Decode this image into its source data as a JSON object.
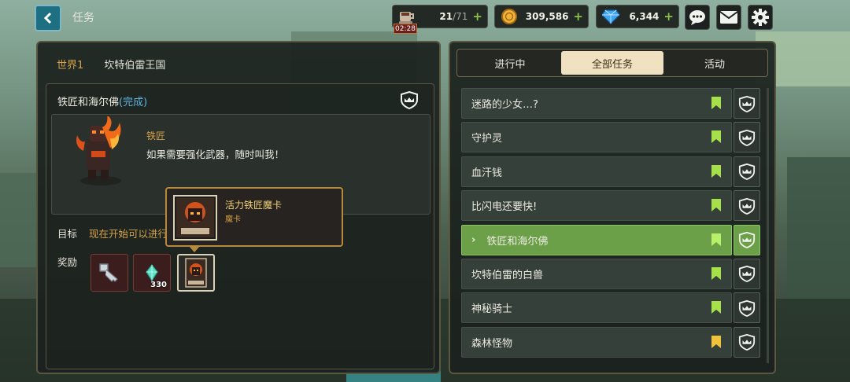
{
  "header": {
    "title": "任务",
    "stamina": {
      "current": "21",
      "max": "/71",
      "timer": "02:28"
    },
    "gold": "309,586",
    "gems": "6,344"
  },
  "left": {
    "world": "世界1",
    "area": "坎特伯雷王国",
    "quest_title": "铁匠和海尔佛",
    "quest_status": "(完成)",
    "npc_name": "铁匠",
    "npc_line": "如果需要强化武器，随时叫我！",
    "goal_label": "目标",
    "goal_text": "现在开始可以进行",
    "reward_label": "奖励",
    "rewards": [
      {
        "icon": "key-icon"
      },
      {
        "icon": "crystal-icon",
        "count": "330"
      },
      {
        "icon": "card-icon"
      }
    ],
    "tooltip": {
      "name": "活力铁匠魔卡",
      "type": "魔卡"
    }
  },
  "right": {
    "tabs": [
      {
        "label": "进行中",
        "active": false
      },
      {
        "label": "全部任务",
        "active": true
      },
      {
        "label": "活动",
        "active": false
      }
    ],
    "quests": [
      {
        "label": "迷路的少女…?",
        "flag": "#a6e04a",
        "active": false
      },
      {
        "label": "守护灵",
        "flag": "#a6e04a",
        "active": false
      },
      {
        "label": "血汗钱",
        "flag": "#a6e04a",
        "active": false
      },
      {
        "label": "比闪电还要快!",
        "flag": "#a6e04a",
        "active": false
      },
      {
        "label": "铁匠和海尔佛",
        "flag": "#b8f06a",
        "active": true
      },
      {
        "label": "坎特伯雷的白兽",
        "flag": "#a6e04a",
        "active": false
      },
      {
        "label": "神秘骑士",
        "flag": "#a6e04a",
        "active": false
      },
      {
        "label": "森林怪物",
        "flag": "#f0c23a",
        "active": false
      }
    ]
  },
  "colors": {
    "accent_green": "#6ba048",
    "gold_text": "#d7a24a",
    "tooltip_border": "#b58a3c"
  }
}
